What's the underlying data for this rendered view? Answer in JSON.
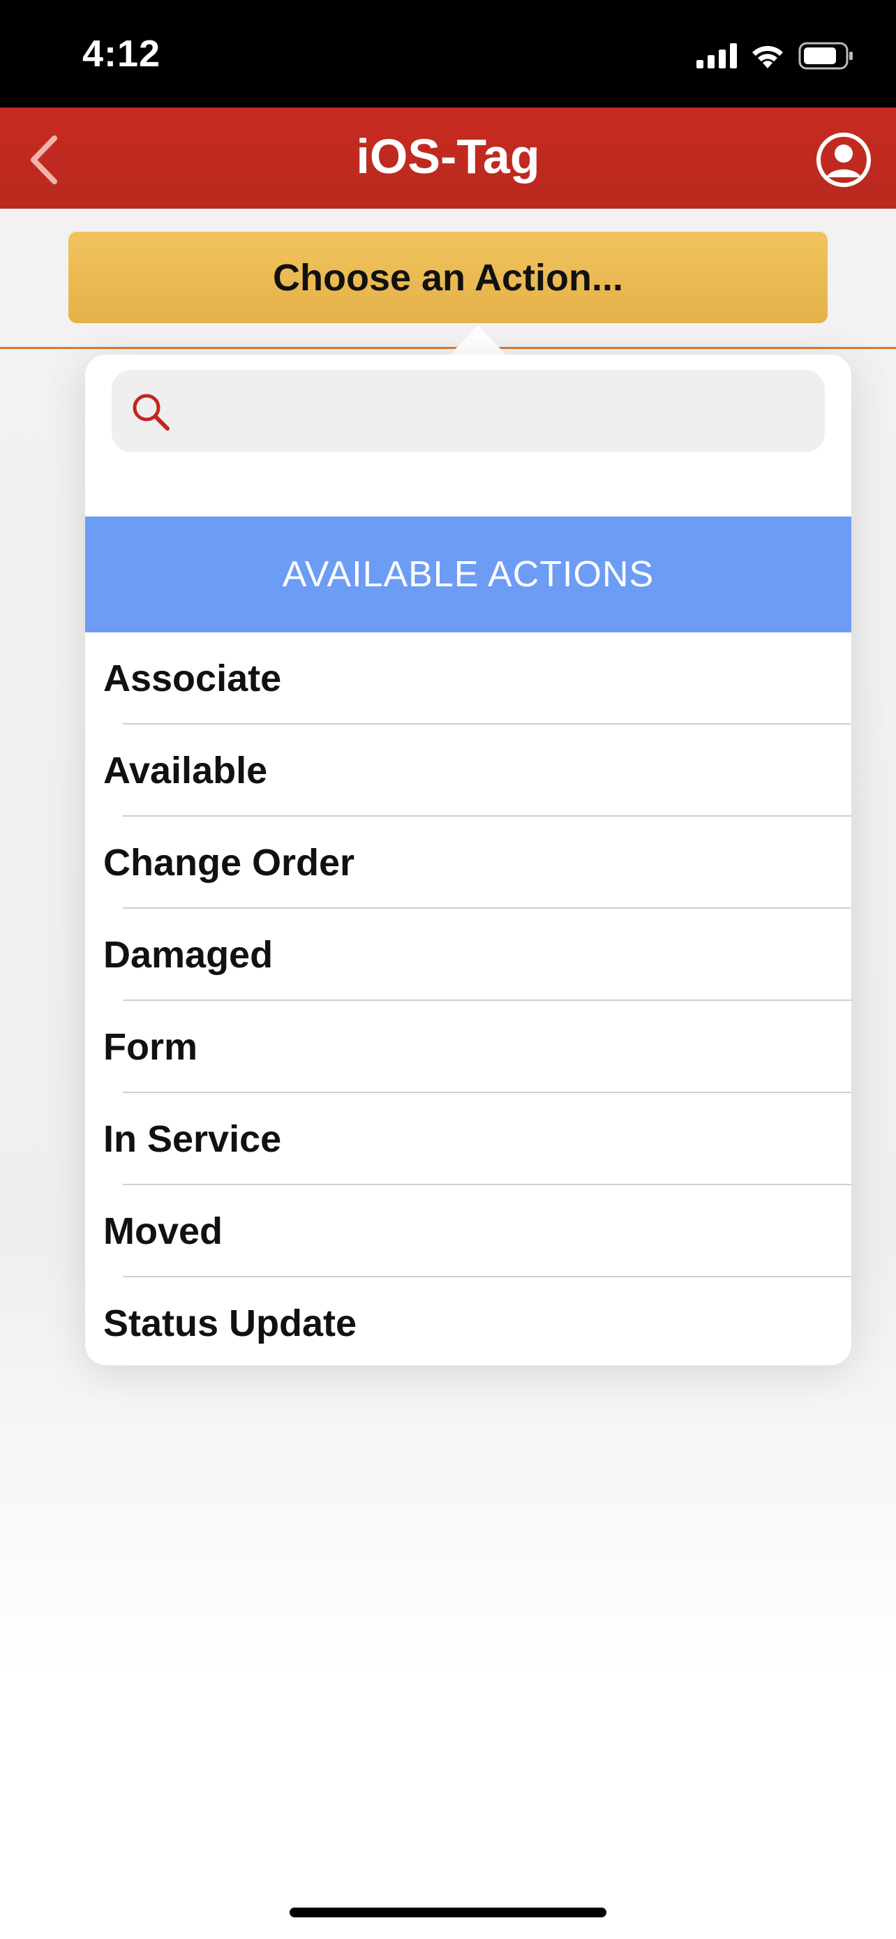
{
  "status_bar": {
    "time": "4:12"
  },
  "nav": {
    "title": "iOS-Tag",
    "back_icon": "chevron-left-icon",
    "profile_icon": "user-circle-icon"
  },
  "action_button": {
    "label": "Choose an Action..."
  },
  "search": {
    "placeholder": "",
    "value": ""
  },
  "actions_panel": {
    "section_title": "AVAILABLE ACTIONS",
    "items": [
      {
        "label": "Associate"
      },
      {
        "label": "Available"
      },
      {
        "label": "Change Order"
      },
      {
        "label": "Damaged"
      },
      {
        "label": "Form"
      },
      {
        "label": "In Service"
      },
      {
        "label": "Moved"
      },
      {
        "label": "Status Update"
      }
    ]
  },
  "colors": {
    "nav_bar": "#c02a20",
    "action_button": "#eebc55",
    "section_header": "#6d9cf5",
    "accent_line": "#e07830"
  }
}
